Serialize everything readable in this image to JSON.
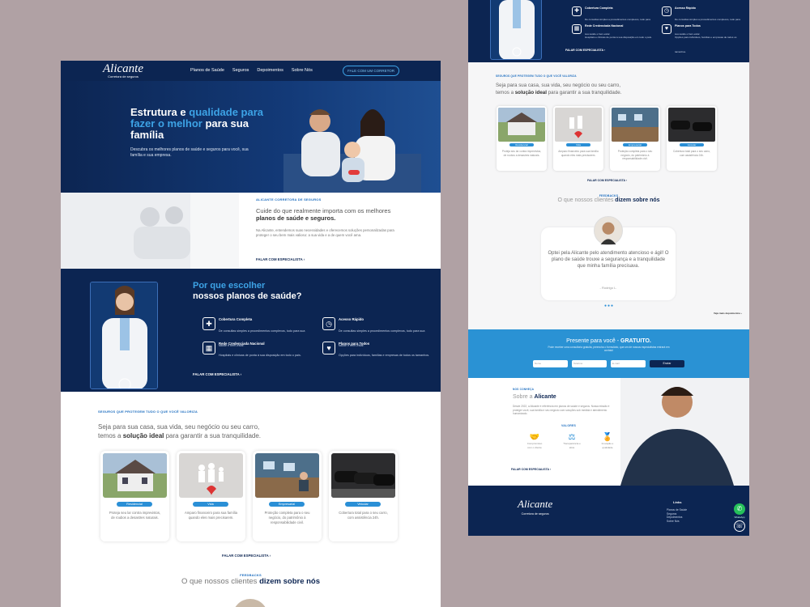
{
  "left": {
    "nav": {
      "logo": "Alicante",
      "logo_sub": "Corretora de seguros",
      "items": [
        "Planos de Saúde",
        "Seguros",
        "Depoimentos",
        "Sobre Nós"
      ],
      "cta": "FALE COM UM CORRETOR"
    },
    "hero": {
      "title_1": "Estrutura e ",
      "title_hl": "qualidade para fazer o melhor",
      "title_2": " para sua família",
      "text": "Descubra os melhores planos de saúde e seguros para você, sua família e sua empresa."
    },
    "about": {
      "kicker": "ALICANTE CORRETORA DE SEGUROS",
      "heading_1": "Cuide do que realmente importa com os melhores ",
      "heading_bold": "planos de saúde e seguros.",
      "text": "Na Alicante, entendemos suas necessidades e oferecemos soluções personalizadas para proteger o seu bem mais valioso: a sua vida e a de quem você ama.",
      "link": "FALAR COM ESPECIALISTA"
    },
    "why": {
      "title_1": "Por que escolher",
      "title_2": "nossos planos de saúde?",
      "features": [
        {
          "title": "Cobertura Completa",
          "text": "De consultas simples a procedimentos complexos, tudo para sua saúde e bem-estar.",
          "icon": "plus-cross-icon"
        },
        {
          "title": "Acesso Rápido",
          "text": "De consultas simples a procedimentos complexos, tudo para sua saúde e bem-estar.",
          "icon": "clock-icon"
        },
        {
          "title": "Rede Credenciada Nacional",
          "text": "Hospitais e clínicas de ponta à sua disposição em todo o país.",
          "icon": "hospital-icon"
        },
        {
          "title": "Planos para Todos",
          "text": "Opções para indivíduos, famílias e empresas de todos os tamanhos.",
          "icon": "hand-heart-icon"
        }
      ],
      "link": "FALAR COM ESPECIALISTA"
    },
    "seguros": {
      "kicker": "SEGUROS QUE PROTEGEM TUDO O QUE VOCÊ VALORIZA",
      "text_1": "Seja para sua casa, sua vida, seu negócio ou seu carro,",
      "text_2": "temos a ",
      "text_bold": "solução ideal",
      "text_3": " para garantir a sua tranquilidade.",
      "cards": [
        {
          "tag": "Residencial",
          "desc": "Proteja seu lar contra imprevistos, de roubos a desastres naturais."
        },
        {
          "tag": "Vida",
          "desc": "Amparo financeiro para sua família quando eles mais precisarem."
        },
        {
          "tag": "Empresarial",
          "desc": "Proteção completa para o seu negócio, do patrimônio à responsabilidade civil."
        },
        {
          "tag": "Veicular",
          "desc": "Cobertura total para o seu carro, com assistência 24h."
        }
      ],
      "link": "FALAR COM ESPECIALISTA"
    },
    "feedback": {
      "kicker": "FEEDBACKS",
      "title_1": "O que nossos clientes ",
      "title_bold": "dizem sobre nós"
    }
  },
  "right": {
    "features": [
      {
        "title": "Cobertura Completa",
        "text": "De consultas simples a procedimentos complexos, tudo para sua saúde e bem-estar."
      },
      {
        "title": "Acesso Rápido",
        "text": "De consultas simples a procedimentos complexos, tudo para sua saúde e bem-estar."
      },
      {
        "title": "Rede Credenciada Nacional",
        "text": "Hospitais e clínicas de ponta à sua disposição em todo o país."
      },
      {
        "title": "Planos para Todos",
        "text": "Opções para indivíduos, famílias e empresas de todos os tamanhos."
      }
    ],
    "top_link": "FALAR COM ESPECIALISTA",
    "seg_kicker": "SEGUROS QUE PROTEGEM TUDO O QUE VOCÊ VALORIZA",
    "seg_text_1": "Seja para sua casa, sua vida, seu negócio ou seu carro,",
    "seg_text_2": "temos a ",
    "seg_bold": "solução ideal",
    "seg_text_3": " para garantir a sua tranquilidade.",
    "cards": [
      {
        "tag": "Residencial",
        "desc": "Proteja seu lar contra imprevistos, de roubos a desastres naturais."
      },
      {
        "tag": "Vida",
        "desc": "Amparo financeiro para sua família quando eles mais precisarem."
      },
      {
        "tag": "Empresarial",
        "desc": "Proteção completa para o seu negócio, do patrimônio à responsabilidade civil."
      },
      {
        "tag": "Veicular",
        "desc": "Cobertura total para o seu carro, com assistência 24h."
      }
    ],
    "seg_link": "FALAR COM ESPECIALISTA",
    "feed_kicker": "FEEDBACKS",
    "feed_title_1": "O que nossos clientes ",
    "feed_bold": "dizem sobre nós",
    "testimonial": "Optei pela Alicante pelo atendimento atencioso e ágil! O plano de saúde trouxe a segurança e a tranquilidade que minha família precisava.",
    "author": "- Rodrigo L.",
    "more": "Veja mais depoimentos",
    "free_title_1": "Presente para você - ",
    "free_bold": "GRATUITO.",
    "free_text": "Pode receber uma consultoria gratuita, preencha o formulário, que um de nossos especialistas entrará em contato!",
    "inputs": [
      "Nome",
      "Telefone",
      "E-mail"
    ],
    "send": "Enviar",
    "about_kicker": "NOS CONHEÇA",
    "about_title_1": "Sobre a ",
    "about_bold": "Alicante",
    "about_text": "Desde 2022, a Alicante é referência em planos de saúde e seguros. Nossa missão é proteger você, sua família e seu negócio com soluções sob medida e atendimento humanizado.",
    "values_title": "VALORES",
    "values": [
      "Compromisso com o cliente",
      "Transparência e ética",
      "Inovação e qualidade"
    ],
    "about_link": "FALAR COM ESPECIALISTA",
    "footer_logo": "Alicante",
    "footer_sub": "Corretora de seguros",
    "links_title": "Links",
    "links": [
      "Planos de Saúde",
      "Seguros",
      "Depoimentos",
      "Sobre Nós"
    ],
    "whatsapp": "WhatsApp"
  },
  "colors": {
    "navy": "#0c2552",
    "accent": "#3da3e6",
    "blue": "#2a92d4"
  }
}
